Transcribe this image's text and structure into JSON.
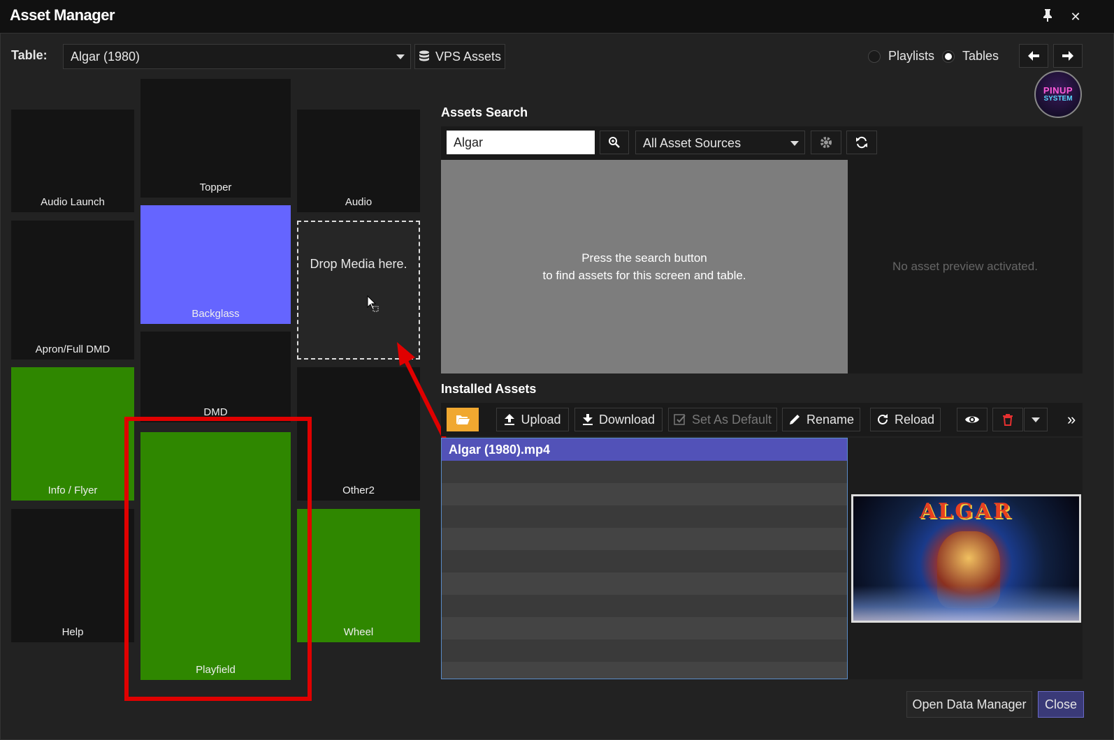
{
  "window": {
    "title": "Asset Manager",
    "pin_icon": "pin-icon",
    "close_icon": "close-icon"
  },
  "toolbar": {
    "table_label": "Table:",
    "table_value": "Algar (1980)",
    "vps_assets_label": "VPS Assets",
    "playlists_label": "Playlists",
    "tables_label": "Tables",
    "selected_mode": "Tables"
  },
  "logo": {
    "text": "PINUP SYSTEM"
  },
  "screens": {
    "audio_launch": "Audio Launch",
    "topper": "Topper",
    "audio": "Audio",
    "apron": "Apron/Full DMD",
    "backglass": "Backglass",
    "drop_zone": "Drop Media here.",
    "dmd": "DMD",
    "info_flyer": "Info / Flyer",
    "other2": "Other2",
    "playfield": "Playfield",
    "help": "Help",
    "wheel": "Wheel"
  },
  "assets_search": {
    "heading": "Assets Search",
    "query": "Algar",
    "source": "All Asset Sources",
    "hint_line1": "Press the search button",
    "hint_line2": "to find assets for this screen and table.",
    "preview_empty": "No asset preview activated."
  },
  "installed_assets": {
    "heading": "Installed Assets",
    "upload_label": "Upload",
    "download_label": "Download",
    "set_default_label": "Set As Default",
    "rename_label": "Rename",
    "reload_label": "Reload",
    "files": [
      "Algar (1980).mp4"
    ],
    "preview_title": "ALGAR"
  },
  "footer": {
    "open_data_manager": "Open Data Manager",
    "close": "Close"
  },
  "colors": {
    "green": "#2f8700",
    "blue": "#6565ff",
    "selection": "#5252b8",
    "annotation_red": "#e00000"
  }
}
